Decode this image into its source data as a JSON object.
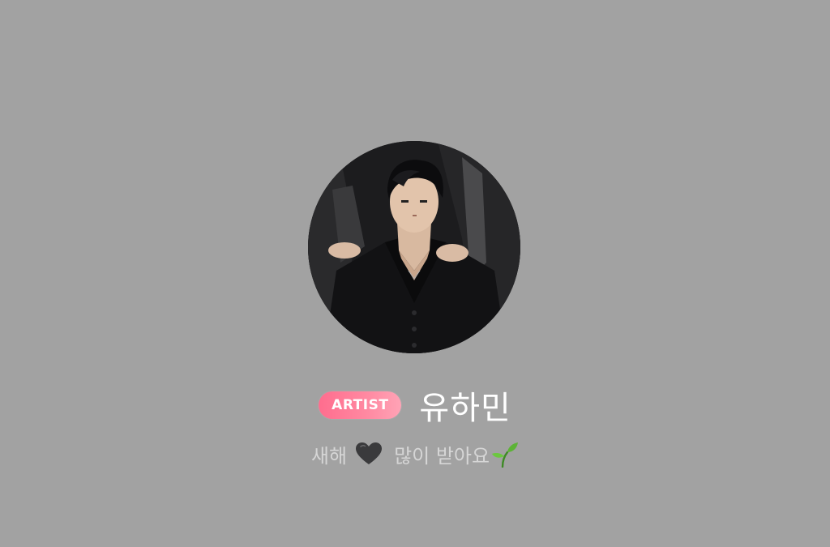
{
  "profile": {
    "badge": "ARTIST",
    "name": "유하민",
    "status_before": "새해",
    "status_after": "많이 받아요",
    "status_icons": [
      "black-heart-icon",
      "sprout-icon"
    ]
  },
  "colors": {
    "background": "#a2a2a2",
    "badge_gradient_start": "#ff6d8e",
    "badge_gradient_end": "#ffa3b6",
    "name_text": "#ffffff",
    "status_text": "#d6d6d6"
  }
}
